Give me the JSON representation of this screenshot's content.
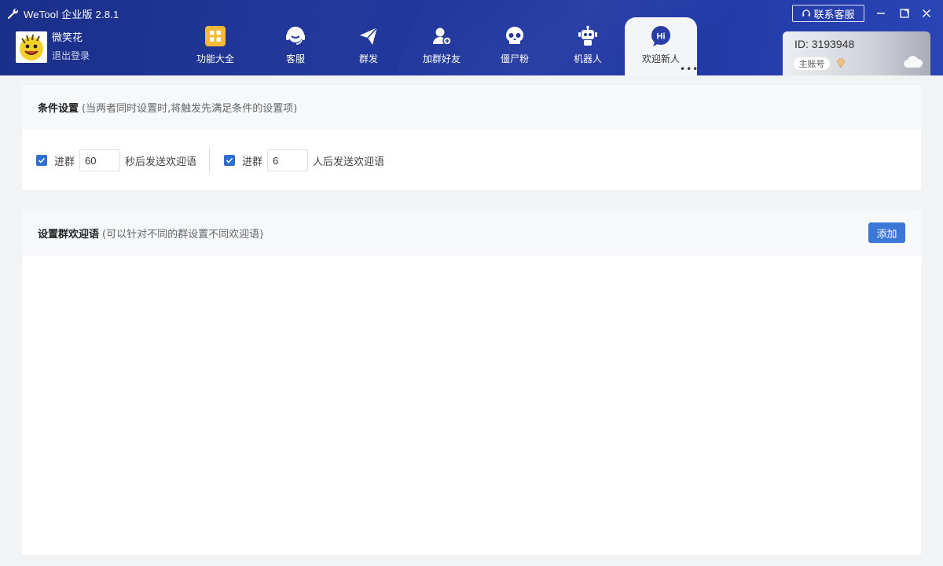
{
  "window": {
    "title": "WeTool 企业版 2.8.1",
    "contact_label": "联系客服"
  },
  "profile": {
    "name": "微笑花",
    "logout": "退出登录"
  },
  "nav": {
    "items": [
      {
        "label": "功能大全",
        "icon": "grid-icon"
      },
      {
        "label": "客服",
        "icon": "headset-icon"
      },
      {
        "label": "群发",
        "icon": "paper-plane-icon"
      },
      {
        "label": "加群好友",
        "icon": "add-user-icon"
      },
      {
        "label": "僵尸粉",
        "icon": "skull-icon"
      },
      {
        "label": "机器人",
        "icon": "robot-icon"
      },
      {
        "label": "欢迎新人",
        "icon": "hi-icon",
        "active": true
      }
    ],
    "more": "•••"
  },
  "account": {
    "id": "ID: 3193948",
    "role": "主账号"
  },
  "conditions": {
    "title": "条件设置",
    "hint": "(当两者同时设置时,将触发先满足条件的设置项)",
    "time_rule": {
      "checked": true,
      "prefix": "进群",
      "value": "60",
      "suffix": "秒后发送欢迎语"
    },
    "count_rule": {
      "checked": true,
      "prefix": "进群",
      "value": "6",
      "suffix": "人后发送欢迎语"
    }
  },
  "welcome": {
    "title": "设置群欢迎语",
    "hint": "(可以针对不同的群设置不同欢迎语)",
    "add_label": "添加"
  },
  "colors": {
    "header": "#1f3596",
    "accent": "#3a77d6",
    "active_tab": "#f4f5f8"
  }
}
